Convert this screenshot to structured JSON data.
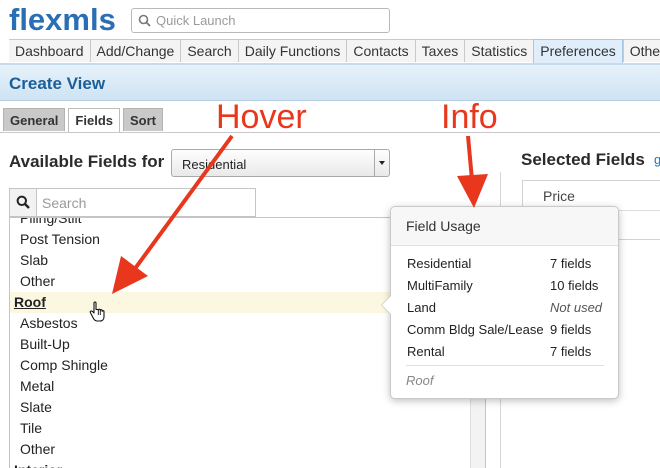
{
  "app": {
    "logo_text": "flexmls"
  },
  "quick_launch": {
    "placeholder": "Quick Launch",
    "icon": "search-icon"
  },
  "nav": {
    "items": [
      {
        "label": "Dashboard",
        "active": false
      },
      {
        "label": "Add/Change",
        "active": false
      },
      {
        "label": "Search",
        "active": false
      },
      {
        "label": "Daily Functions",
        "active": false
      },
      {
        "label": "Contacts",
        "active": false
      },
      {
        "label": "Taxes",
        "active": false
      },
      {
        "label": "Statistics",
        "active": false
      },
      {
        "label": "Preferences",
        "active": true
      },
      {
        "label": "Other",
        "active": false
      }
    ]
  },
  "page": {
    "title": "Create View"
  },
  "subtabs": [
    {
      "label": "General",
      "active": false
    },
    {
      "label": "Fields",
      "active": true
    },
    {
      "label": "Sort",
      "active": false
    }
  ],
  "available": {
    "label": "Available Fields for",
    "property_class": "Residential",
    "search_placeholder": "Search",
    "rows": [
      {
        "label": "Piling/Stilt",
        "group": false,
        "hover": false
      },
      {
        "label": "Post Tension",
        "group": false,
        "hover": false
      },
      {
        "label": "Slab",
        "group": false,
        "hover": false
      },
      {
        "label": "Other",
        "group": false,
        "hover": false
      },
      {
        "label": "Roof",
        "group": true,
        "hover": true
      },
      {
        "label": "Asbestos",
        "group": false,
        "hover": false
      },
      {
        "label": "Built-Up",
        "group": false,
        "hover": false
      },
      {
        "label": "Comp Shingle",
        "group": false,
        "hover": false
      },
      {
        "label": "Metal",
        "group": false,
        "hover": false
      },
      {
        "label": "Slate",
        "group": false,
        "hover": false
      },
      {
        "label": "Tile",
        "group": false,
        "hover": false
      },
      {
        "label": "Other",
        "group": false,
        "hover": false
      },
      {
        "label": "Interior",
        "group": true,
        "hover": false
      }
    ]
  },
  "selected": {
    "label": "Selected Fields",
    "link_text": "g",
    "items": [
      "Price"
    ]
  },
  "popover": {
    "title": "Field Usage",
    "rows": [
      {
        "name": "Residential",
        "value": "7 fields",
        "muted": false
      },
      {
        "name": "MultiFamily",
        "value": "10 fields",
        "muted": false
      },
      {
        "name": "Land",
        "value": "Not used",
        "muted": true
      },
      {
        "name": "Comm Bldg Sale/Lease",
        "value": "9 fields",
        "muted": false
      },
      {
        "name": "Rental",
        "value": "7 fields",
        "muted": false
      }
    ],
    "footer": "Roof"
  },
  "annotations": {
    "hover_label": "Hover",
    "info_label": "Info",
    "color": "#e8371c"
  },
  "colors": {
    "brand": "#2a6fb3",
    "band": "#dbeaf6",
    "hover_row": "#fbf7e0"
  }
}
